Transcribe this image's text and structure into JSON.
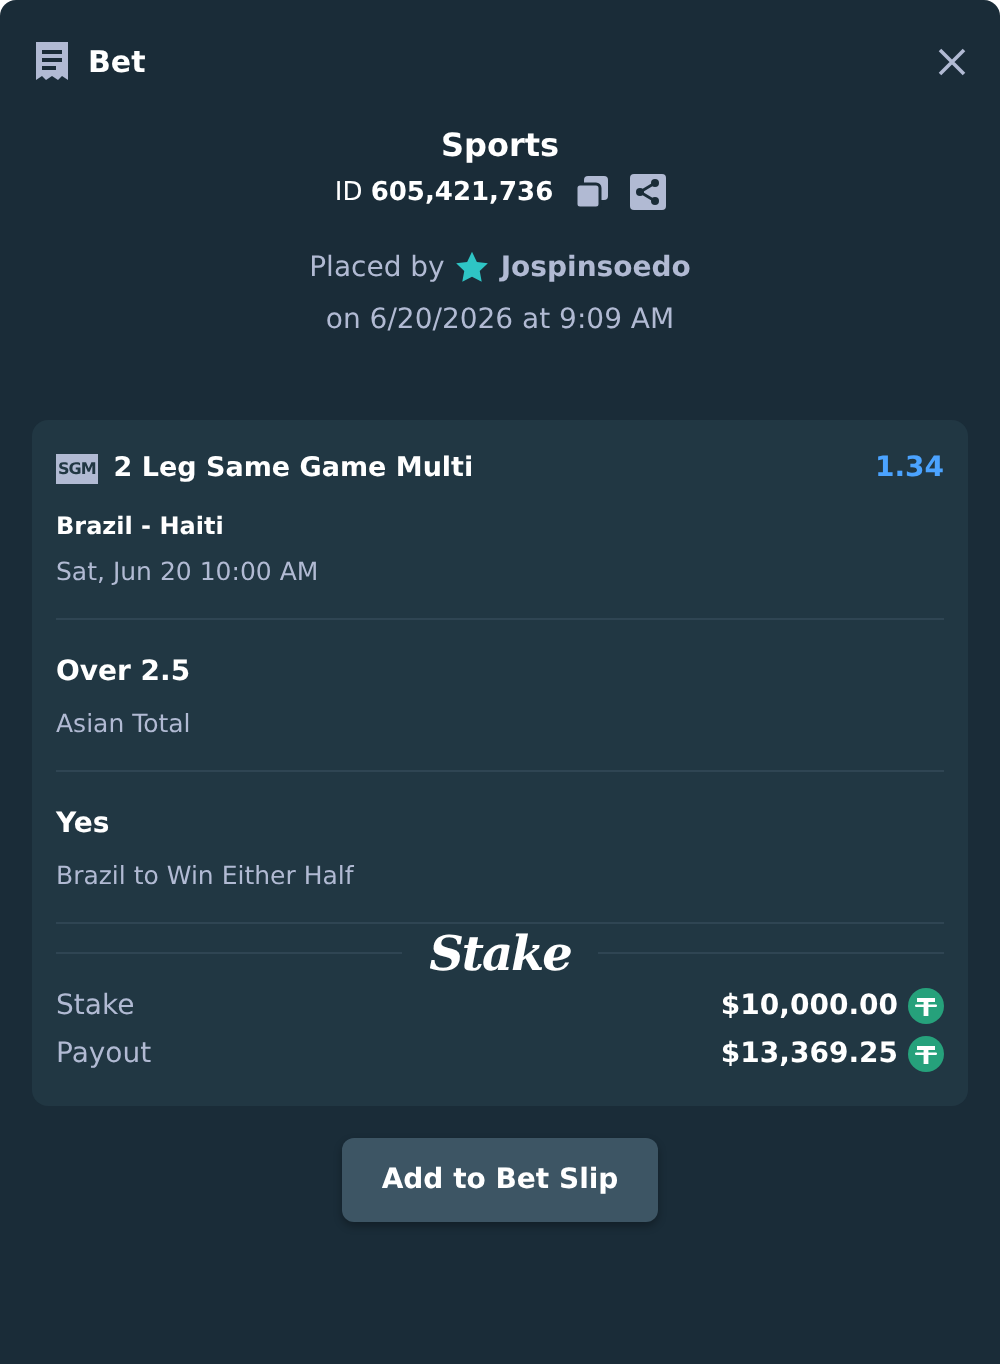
{
  "header": {
    "title": "Bet"
  },
  "summary": {
    "category": "Sports",
    "id_label": "ID",
    "id_value": "605,421,736",
    "placed_by_label": "Placed by",
    "user": "Jospinsoedo",
    "placed_on": "on 6/20/2026 at 9:09 AM"
  },
  "bet": {
    "badge": "SGM",
    "title": "2 Leg Same Game Multi",
    "odds": "1.34",
    "event": "Brazil - Haiti",
    "event_time": "Sat, Jun 20 10:00 AM",
    "legs": [
      {
        "selection": "Over 2.5",
        "market": "Asian Total"
      },
      {
        "selection": "Yes",
        "market": "Brazil to Win Either Half"
      }
    ],
    "logo": "Stake",
    "totals": [
      {
        "label": "Stake",
        "amount": "$10,000.00"
      },
      {
        "label": "Payout",
        "amount": "$13,369.25"
      }
    ]
  },
  "button": "Add to Bet Slip"
}
